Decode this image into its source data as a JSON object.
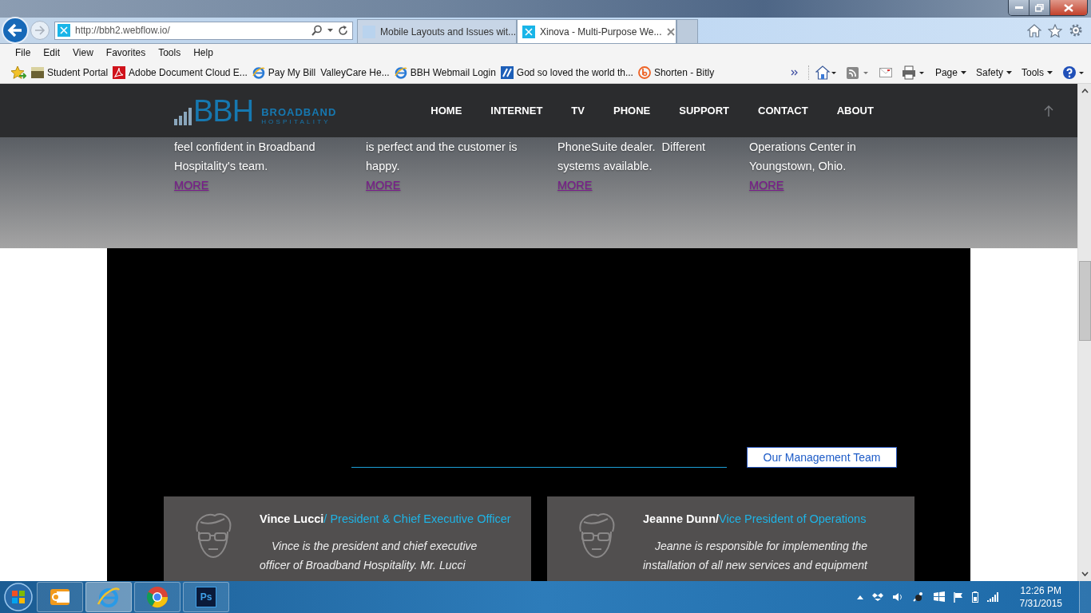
{
  "browser": {
    "url": "http://bbh2.webflow.io/",
    "tabs": [
      {
        "label": "Mobile Layouts and Issues wit...",
        "selected": false
      },
      {
        "label": "Xinova - Multi-Purpose We...",
        "selected": true
      }
    ],
    "menu_bar": [
      "File",
      "Edit",
      "View",
      "Favorites",
      "Tools",
      "Help"
    ],
    "favorites": [
      {
        "label": "Student Portal",
        "kind": "photo"
      },
      {
        "label": "Adobe Document Cloud E...",
        "kind": "pdf"
      },
      {
        "label": "Pay My Bill",
        "kind": "ie"
      },
      {
        "label": "ValleyCare He...",
        "kind": "plain"
      },
      {
        "label": "BBH Webmail Login",
        "kind": "ie"
      },
      {
        "label": "God so loved the world th...",
        "kind": "tile"
      },
      {
        "label": "Shorten - Bitly",
        "kind": "bitly"
      }
    ],
    "command_bar": [
      "Page",
      "Safety",
      "Tools"
    ]
  },
  "site": {
    "logo": {
      "mark": "BBH",
      "line1": "BROADBAND",
      "line2": "HOSPITALITY"
    },
    "nav": [
      "HOME",
      "INTERNET",
      "TV",
      "PHONE",
      "SUPPORT",
      "CONTACT",
      "ABOUT"
    ],
    "features": [
      {
        "lines": [
          "feel confident in Broadband",
          "Hospitality's team."
        ],
        "link": "MORE"
      },
      {
        "lines": [
          "is perfect and the customer is",
          "happy."
        ],
        "link": "MORE"
      },
      {
        "lines": [
          "PhoneSuite dealer.  Different",
          "systems available."
        ],
        "link": "MORE"
      },
      {
        "lines": [
          "Operations Center in",
          "Youngstown, Ohio."
        ],
        "link": "MORE"
      }
    ],
    "section_button": "Our Management Team",
    "team": [
      {
        "name": "Vince Lucci",
        "title": "/ President & Chief Executive Officer",
        "bio": "Vince is the president and chief executive officer of Broadband Hospitality. Mr. Lucci"
      },
      {
        "name": "Jeanne Dunn/",
        "title": "Vice President of Operations",
        "bio": "Jeanne is responsible for implementing the installation of all new services and equipment"
      }
    ]
  },
  "taskbar": {
    "apps": [
      {
        "kind": "outlook",
        "selected": false
      },
      {
        "kind": "ie",
        "selected": true
      },
      {
        "kind": "chrome",
        "selected": false
      },
      {
        "kind": "photoshop",
        "label": "Ps",
        "selected": false
      }
    ],
    "time": "12:26 PM",
    "date": "7/31/2015"
  }
}
